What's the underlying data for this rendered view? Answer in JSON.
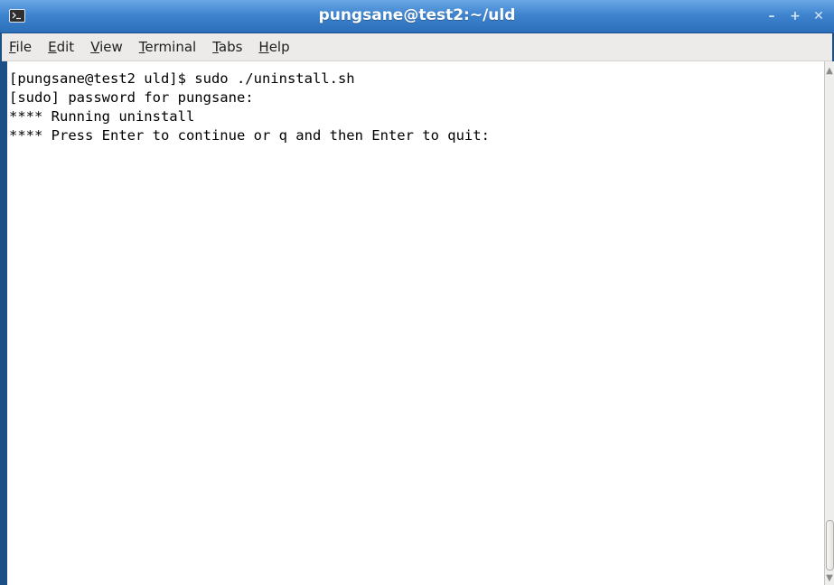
{
  "window": {
    "title": "pungsane@test2:~/uld",
    "app_icon": "terminal-icon",
    "controls": [
      {
        "name": "minimize-icon",
        "glyph": "–"
      },
      {
        "name": "maximize-icon",
        "glyph": "+"
      },
      {
        "name": "close-icon",
        "glyph": "✕"
      }
    ]
  },
  "menubar": {
    "items": [
      {
        "mnemonic": "F",
        "rest": "ile"
      },
      {
        "mnemonic": "E",
        "rest": "dit"
      },
      {
        "mnemonic": "V",
        "rest": "iew"
      },
      {
        "mnemonic": "T",
        "rest": "erminal"
      },
      {
        "mnemonic": "T",
        "rest": "abs"
      },
      {
        "mnemonic": "H",
        "rest": "elp"
      }
    ]
  },
  "terminal": {
    "lines": [
      "[pungsane@test2 uld]$ sudo ./uninstall.sh",
      "[sudo] password for pungsane:",
      "**** Running uninstall",
      "**** Press Enter to continue or q and then Enter to quit:"
    ]
  },
  "scrollbar": {
    "up_glyph": "▲",
    "down_glyph": "▼"
  },
  "colors": {
    "titlebar": "#3f84cf",
    "menubar": "#ecebea",
    "terminal_bg": "#ffffff",
    "terminal_fg": "#000000"
  }
}
